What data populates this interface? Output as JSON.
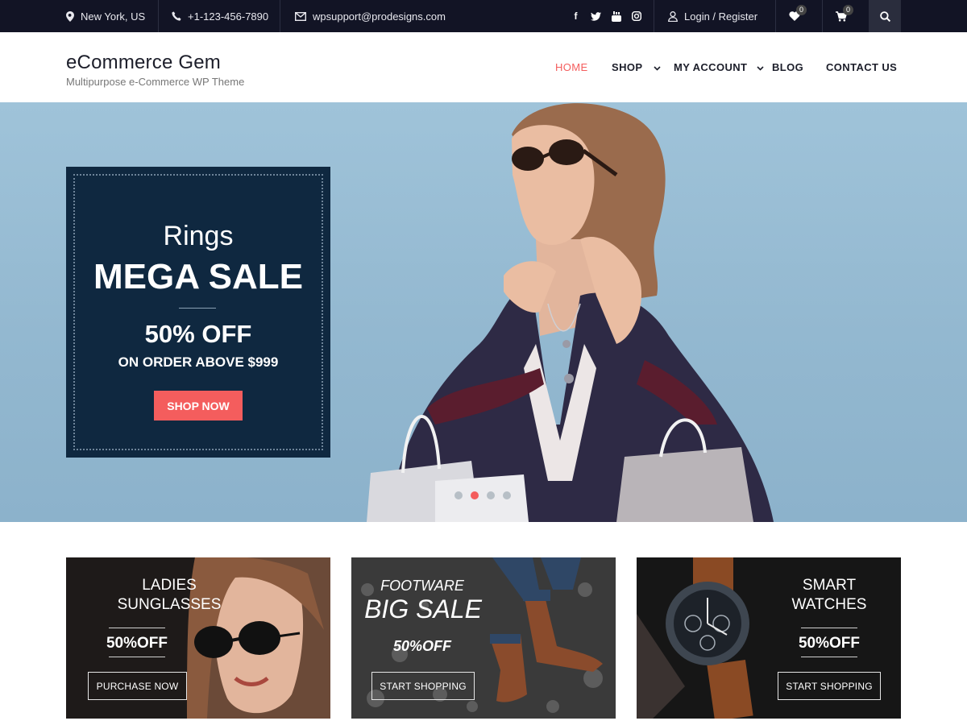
{
  "topbar": {
    "location": "New York, US",
    "phone": "+1-123-456-7890",
    "email": "wpsupport@prodesigns.com",
    "login": "Login / Register",
    "wishlist_count": "0",
    "cart_count": "0",
    "social_icons": [
      "facebook-icon",
      "twitter-icon",
      "youtube-icon",
      "instagram-icon"
    ]
  },
  "header": {
    "site_title": "eCommerce Gem",
    "tagline": "Multipurpose e-Commerce WP Theme",
    "nav": [
      {
        "label": "HOME",
        "active": true
      },
      {
        "label": "SHOP",
        "dropdown": true
      },
      {
        "label": "MY ACCOUNT",
        "dropdown": true
      },
      {
        "label": "BLOG"
      },
      {
        "label": "CONTACT US"
      }
    ]
  },
  "hero": {
    "title": "Rings",
    "headline": "MEGA SALE",
    "offer": "50% OFF",
    "subline": "ON ORDER ABOVE $999",
    "button": "SHOP NOW",
    "slide_count": 4,
    "active_slide": 2
  },
  "cards": [
    {
      "line1": "LADIES",
      "line2": "SUNGLASSES",
      "offer": "50%OFF",
      "button": "PURCHASE NOW"
    },
    {
      "line1": "FOOTWARE",
      "line2": "BIG SALE",
      "offer": "50%OFF",
      "button": "START SHOPPING"
    },
    {
      "line1": "SMART",
      "line2": "WATCHES",
      "offer": "50%OFF",
      "button": "START SHOPPING"
    }
  ],
  "colors": {
    "accent": "#f45d5d",
    "topbar": "#121425",
    "promo": "#0f2840"
  }
}
